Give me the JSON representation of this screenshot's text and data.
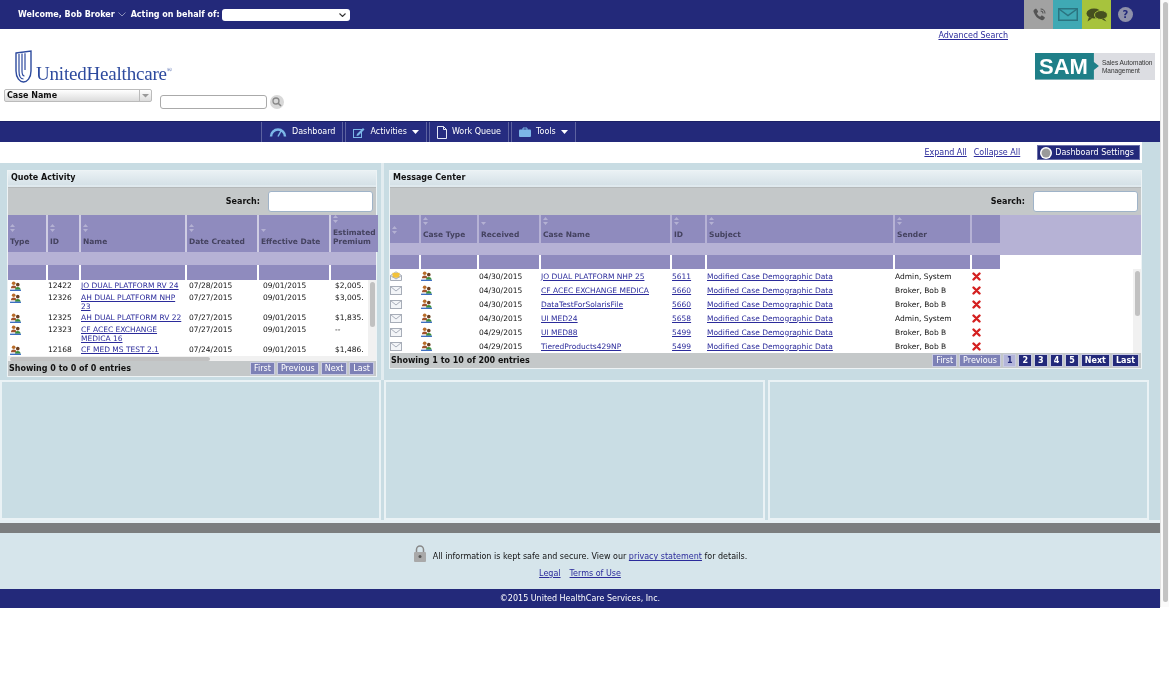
{
  "top_bar": {
    "welcome": "Welcome, Bob Broker",
    "behalf_label": "Acting on behalf of:",
    "quick_buttons": [
      {
        "kind": "phone"
      },
      {
        "kind": "mail"
      },
      {
        "kind": "chat"
      },
      {
        "kind": "help",
        "label": "?"
      }
    ]
  },
  "header": {
    "advanced_search": "Advanced Search",
    "logo_text": "UnitedHealthcare$^{®}$",
    "sam_logo": {
      "title": "SAM",
      "subtitle": "Sales Automation Management"
    },
    "search_type": "Case Name"
  },
  "nav": [
    {
      "label": "Dashboard",
      "kind": "gauge",
      "has_menu": false
    },
    {
      "label": "Activities",
      "kind": "edit",
      "has_menu": true
    },
    {
      "label": "Work Queue",
      "kind": "document",
      "has_menu": false
    },
    {
      "label": "Tools",
      "kind": "briefcase",
      "has_menu": true
    }
  ],
  "dashboard_toolbar": {
    "links": [
      "Expand All",
      "Collapse All"
    ],
    "settings_button": "Dashboard Settings"
  },
  "quote_activity": {
    "title": "Quote Activity",
    "search_label": "Search:",
    "columns": [
      {
        "label": "Type",
        "sorted": false
      },
      {
        "label": "ID",
        "sorted": false
      },
      {
        "label": "Name",
        "sorted": false
      },
      {
        "label": "Date Created",
        "sorted": false
      },
      {
        "label": "Effective Date",
        "sorted": true
      },
      {
        "label": "Estimated Premium",
        "sorted": false
      }
    ],
    "rows": [
      {
        "id": "12422",
        "name": "JO DUAL PLATFORM RV 24",
        "date_created": "07/28/2015",
        "effective_date": "09/01/2015",
        "premium": "$2,005."
      },
      {
        "id": "12326",
        "name": "AH DUAL PLATFORM NHP 23",
        "date_created": "07/27/2015",
        "effective_date": "09/01/2015",
        "premium": "$3,005."
      },
      {
        "id": "12325",
        "name": "AH DUAL PLATFORM RV 22",
        "date_created": "07/27/2015",
        "effective_date": "09/01/2015",
        "premium": "$1,835."
      },
      {
        "id": "12323",
        "name": "CF ACEC EXCHANGE MEDICA 16",
        "date_created": "07/27/2015",
        "effective_date": "09/01/2015",
        "premium": "--"
      },
      {
        "id": "12168",
        "name": "CF MED MS TEST 2.1",
        "date_created": "07/24/2015",
        "effective_date": "09/01/2015",
        "premium": "$1,486."
      }
    ],
    "info": "Showing 0 to 0 of 0 entries",
    "pager": [
      {
        "label": "First",
        "disabled": true,
        "selected": false
      },
      {
        "label": "Previous",
        "disabled": true,
        "selected": false
      },
      {
        "label": "Next",
        "disabled": true,
        "selected": false
      },
      {
        "label": "Last",
        "disabled": true,
        "selected": false
      }
    ]
  },
  "message_center": {
    "title": "Message Center",
    "search_label": "Search:",
    "columns": [
      {
        "sortable": true,
        "sorted": false
      },
      {
        "label": "Case Type",
        "sortable": true,
        "sorted": false
      },
      {
        "label": "Received",
        "sortable": true,
        "sorted": true
      },
      {
        "label": "Case Name",
        "sortable": true,
        "sorted": false
      },
      {
        "label": "ID",
        "sortable": true,
        "sorted": false
      },
      {
        "label": "Subject",
        "sortable": true,
        "sorted": false
      },
      {
        "label": "Sender",
        "sortable": true,
        "sorted": false
      },
      {
        "sortable": false
      }
    ],
    "rows": [
      {
        "unread": true,
        "received": "04/30/2015",
        "case_name": "JO DUAL PLATFORM NHP 25",
        "id": "5611",
        "subject": "Modified Case Demographic Data",
        "sender": "Admin, System"
      },
      {
        "unread": false,
        "received": "04/30/2015",
        "case_name": "CF ACEC EXCHANGE MEDICA",
        "id": "5660",
        "subject": "Modified Case Demographic Data",
        "sender": "Broker, Bob B"
      },
      {
        "unread": false,
        "received": "04/30/2015",
        "case_name": "DataTestForSolarisFile",
        "id": "5660",
        "subject": "Modified Case Demographic Data",
        "sender": "Broker, Bob B"
      },
      {
        "unread": false,
        "received": "04/30/2015",
        "case_name": "UI MED24",
        "id": "5658",
        "subject": "Modified Case Demographic Data",
        "sender": "Admin, System"
      },
      {
        "unread": false,
        "received": "04/29/2015",
        "case_name": "UI MED88",
        "id": "5499",
        "subject": "Modified Case Demographic Data",
        "sender": "Broker, Bob B"
      },
      {
        "unread": false,
        "received": "04/29/2015",
        "case_name": "TieredProducts429NP",
        "id": "5499",
        "subject": "Modified Case Demographic Data",
        "sender": "Broker, Bob B"
      }
    ],
    "info": "Showing 1 to 10 of 200 entries",
    "pager": [
      {
        "label": "First",
        "disabled": true,
        "selected": false
      },
      {
        "label": "Previous",
        "disabled": true,
        "selected": false
      },
      {
        "label": "1",
        "disabled": false,
        "selected": true
      },
      {
        "label": "2",
        "disabled": false,
        "selected": false
      },
      {
        "label": "3",
        "disabled": false,
        "selected": false
      },
      {
        "label": "4",
        "disabled": false,
        "selected": false
      },
      {
        "label": "5",
        "disabled": false,
        "selected": false
      },
      {
        "label": "Next",
        "disabled": false,
        "selected": false
      },
      {
        "label": "Last",
        "disabled": false,
        "selected": false
      }
    ]
  },
  "footer": {
    "notice_before": "All information is kept safe and secure.  View our",
    "notice_link": "privacy statement",
    "notice_after": "for details.",
    "links": [
      "Legal",
      "Terms of Use"
    ],
    "copyright": "©2015 United HealthCare Services, Inc."
  }
}
